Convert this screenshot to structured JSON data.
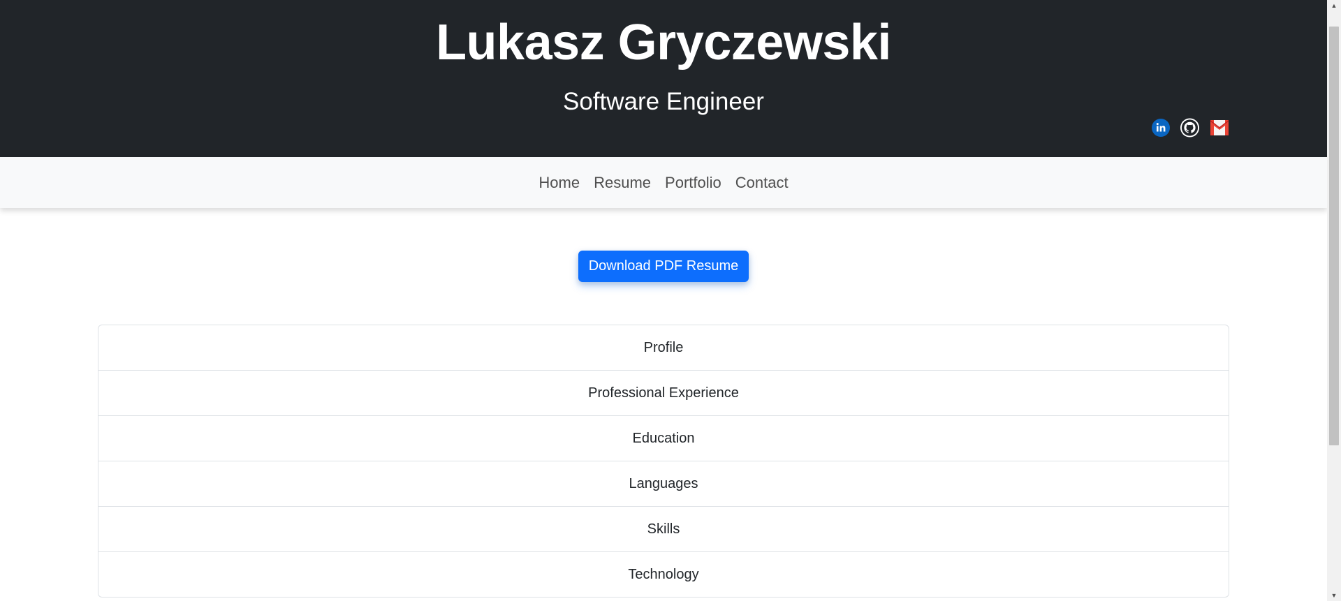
{
  "header": {
    "name": "Lukasz Gryczewski",
    "subtitle": "Software Engineer",
    "social": [
      {
        "icon": "linkedin-icon",
        "label": "in",
        "color": "#0a66c2"
      },
      {
        "icon": "github-icon",
        "color": "#ffffff"
      },
      {
        "icon": "gmail-icon",
        "color": "#ea4335"
      }
    ]
  },
  "nav": {
    "items": [
      "Home",
      "Resume",
      "Portfolio",
      "Contact"
    ]
  },
  "main": {
    "download_label": "Download PDF Resume",
    "sections": [
      "Profile",
      "Professional Experience",
      "Education",
      "Languages",
      "Skills",
      "Technology"
    ]
  },
  "colors": {
    "header_bg": "#212529",
    "nav_bg": "#f8f9fa",
    "button_bg": "#0d6efd"
  }
}
